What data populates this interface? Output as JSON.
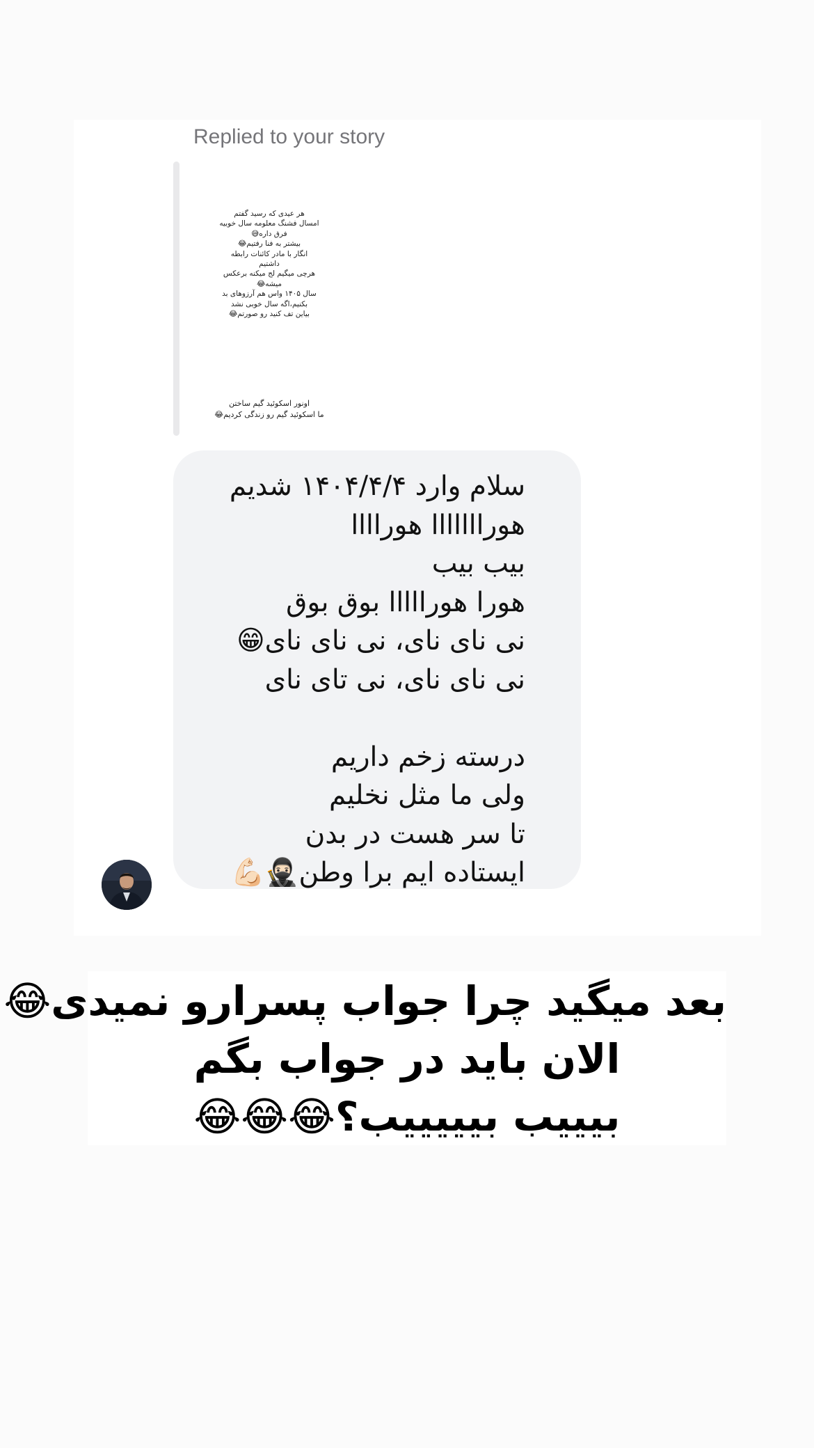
{
  "chat": {
    "reply_label": "Replied to your story",
    "story": {
      "lines": [
        "هر عیدی که رسید گفتم",
        "امسال فشنگ معلومه سال خوبیه",
        "فرق داره😅",
        "بیشتر به فنا رفتیم😂",
        "انگار با مادر کائنات رابطه",
        "داشتیم",
        "هرچی میگیم لج میکنه برعکس",
        "میشه😂",
        "سال ۱۴۰۵ واس هم آرزوهای بد",
        "بکنیم،اگه سال خوبی نشد",
        "بیاین تف کنید رو صورتم😂"
      ],
      "lines_2": [
        "اونور اسکوئید گیم ساختن",
        "ما اسکوئید گیم رو زندگی کردیم😂"
      ]
    },
    "message": {
      "lines": [
        "سلام وارد ۱۴۰۴/۴/۴ شدیم",
        "هورااااااا هوراااا",
        "بیب بیب",
        "هورا هورااااا بوق بوق",
        "نی نای نای، نی نای نای😁",
        "نی نای نای، نی تای نای",
        "",
        "درسته زخم داریم",
        "ولی ما مثل نخلیم",
        "تا سر هست در بدن",
        "ایستاده ایم برا وطن🥷🏻💪🏻"
      ]
    },
    "avatar_label": "sender-avatar"
  },
  "caption": {
    "lines": [
      "بعد میگید چرا جواب پسرارو نمیدی😂",
      "الان باید در جواب بگم",
      "بیییب بیییییب؟😂😂😂"
    ]
  },
  "colors": {
    "page_bg": "#fbfbfb",
    "card_bg": "#ffffff",
    "bubble_bg": "#f2f3f5",
    "reply_label": "#757579",
    "story_bar": "#e9e9eb"
  }
}
